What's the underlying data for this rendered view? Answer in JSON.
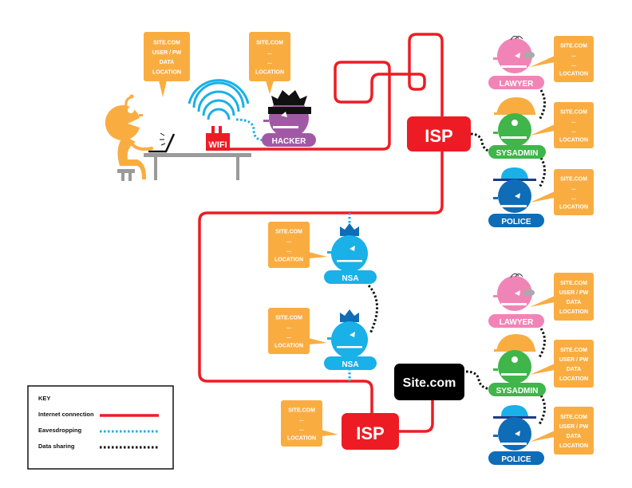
{
  "colors": {
    "internet": "#ed1c24",
    "eavesdrop": "#1ab0e8",
    "sharing": "#111111",
    "bubble": "#f9ad41",
    "user": "#f9ad41",
    "hacker": "#a259a5",
    "lawyer": "#f184b7",
    "sysadmin": "#3fb54a",
    "police": "#0f6cb6",
    "police_hat": "#1ab0e8",
    "nsa": "#1ab0e8",
    "nsa_hat": "#0f6cb6",
    "helmet": "#f9ad41",
    "table": "#9a9a9a",
    "site": "#000000"
  },
  "bubbles": {
    "user": [
      "SITE.COM",
      "USER / PW",
      "DATA",
      "LOCATION"
    ],
    "hacker": [
      "SITE.COM",
      "...",
      "...",
      "LOCATION"
    ],
    "lawyer_top": [
      "SITE.COM",
      "...",
      "...",
      "LOCATION"
    ],
    "sysadmin_top": [
      "SITE.COM",
      "...",
      "...",
      "LOCATION"
    ],
    "police_top": [
      "SITE.COM",
      "...",
      "...",
      "LOCATION"
    ],
    "nsa_top": [
      "SITE.COM",
      "...",
      "...",
      "LOCATION"
    ],
    "nsa_bottom": [
      "SITE.COM",
      "...",
      "...",
      "LOCATION"
    ],
    "isp_bottom": [
      "SITE.COM",
      "...",
      "...",
      "LOCATION"
    ],
    "lawyer_bottom": [
      "SITE.COM",
      "USER / PW",
      "DATA",
      "LOCATION"
    ],
    "sysadmin_bottom": [
      "SITE.COM",
      "USER / PW",
      "DATA",
      "LOCATION"
    ],
    "police_bottom": [
      "SITE.COM",
      "USER / PW",
      "DATA",
      "LOCATION"
    ]
  },
  "labels": {
    "wifi": "WIFI",
    "hacker": "HACKER",
    "isp_top": "ISP",
    "isp_bottom": "ISP",
    "site": "Site.com",
    "lawyer": "LAWYER",
    "sysadmin": "SYSADMIN",
    "police": "POLICE",
    "nsa": "NSA"
  },
  "key": {
    "title": "KEY",
    "items": [
      {
        "label": "Internet connection",
        "style": "internet"
      },
      {
        "label": "Eavesdropping",
        "style": "eavesdrop"
      },
      {
        "label": "Data sharing",
        "style": "sharing"
      }
    ]
  }
}
